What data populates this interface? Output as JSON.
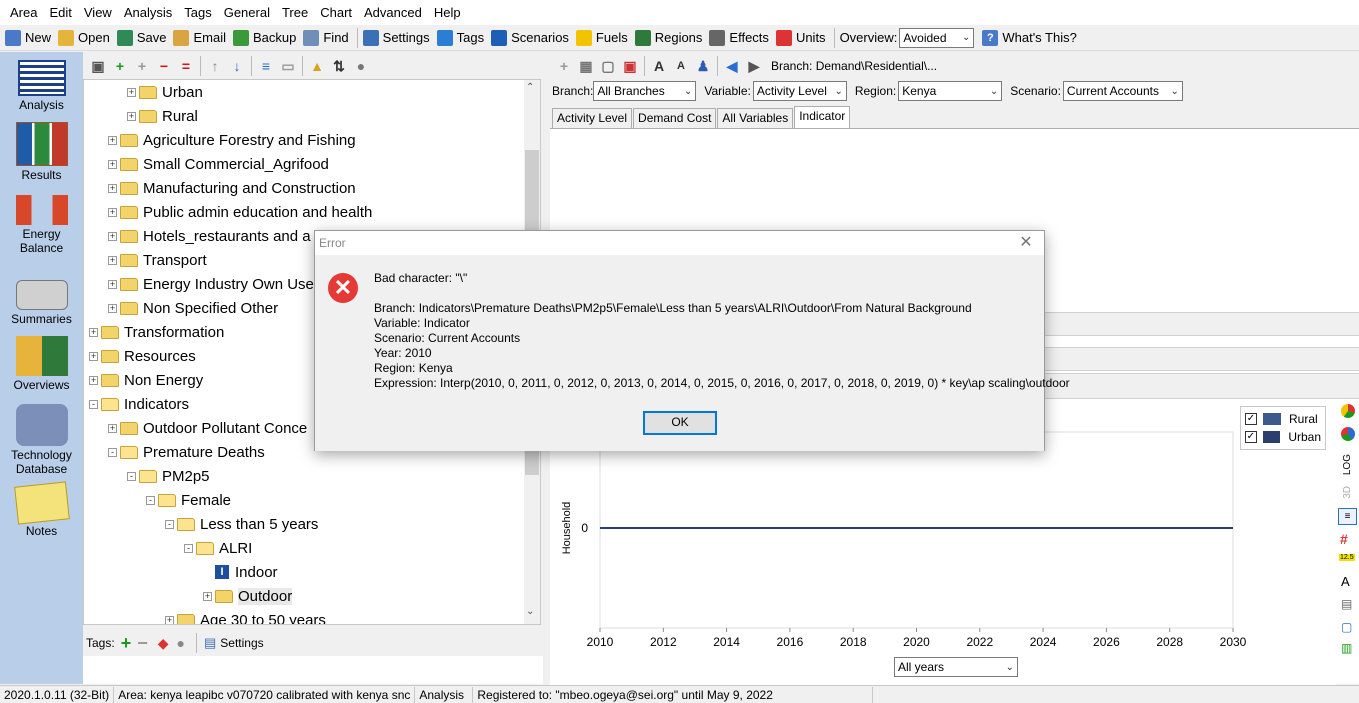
{
  "menu": [
    "Area",
    "Edit",
    "View",
    "Analysis",
    "Tags",
    "General",
    "Tree",
    "Chart",
    "Advanced",
    "Help"
  ],
  "toolbar": {
    "items": [
      {
        "label": "New",
        "icon": "new-file-icon",
        "color": "#4a79c9"
      },
      {
        "label": "Open",
        "icon": "open-folder-icon",
        "color": "#e4b43b"
      },
      {
        "label": "Save",
        "icon": "save-icon",
        "color": "#2e8b57"
      },
      {
        "label": "Email",
        "icon": "email-icon",
        "color": "#d9a441"
      },
      {
        "label": "Backup",
        "icon": "backup-icon",
        "color": "#3a9a3a"
      },
      {
        "label": "Find",
        "icon": "find-icon",
        "color": "#6f8fb8"
      }
    ],
    "items2": [
      {
        "label": "Settings",
        "icon": "settings-icon",
        "color": "#3b6fb6"
      },
      {
        "label": "Tags",
        "icon": "tag-icon",
        "color": "#2a7fd4"
      },
      {
        "label": "Scenarios",
        "icon": "scenarios-icon",
        "color": "#1d5fb5"
      },
      {
        "label": "Fuels",
        "icon": "fuels-icon",
        "color": "#f2c400"
      },
      {
        "label": "Regions",
        "icon": "globe-icon",
        "color": "#2f7a3a"
      },
      {
        "label": "Effects",
        "icon": "effects-cloud-icon",
        "color": "#666"
      },
      {
        "label": "Units",
        "icon": "units-icon",
        "color": "#d33"
      }
    ],
    "overview_label": "Overview:",
    "overview_value": "Avoided",
    "whats_this": "What's This?"
  },
  "sidebar": [
    {
      "label": "Analysis",
      "icon": "analysis-icon"
    },
    {
      "label": "Results",
      "icon": "results-chart-icon"
    },
    {
      "label": "Energy Balance",
      "icon": "energy-balance-icon"
    },
    {
      "label": "Summaries",
      "icon": "summaries-icon"
    },
    {
      "label": "Overviews",
      "icon": "overviews-icon"
    },
    {
      "label": "Technology Database",
      "icon": "technology-database-icon"
    },
    {
      "label": "Notes",
      "icon": "notes-icon"
    }
  ],
  "tree": [
    {
      "label": "Urban",
      "level": 2,
      "exp": "+"
    },
    {
      "label": "Rural",
      "level": 2,
      "exp": "+"
    },
    {
      "label": "Agriculture Forestry and Fishing",
      "level": 1,
      "exp": "+"
    },
    {
      "label": "Small Commercial_Agrifood",
      "level": 1,
      "exp": "+"
    },
    {
      "label": "Manufacturing and Construction",
      "level": 1,
      "exp": "+"
    },
    {
      "label": "Public admin education and health",
      "level": 1,
      "exp": "+"
    },
    {
      "label": "Hotels_restaurants and a",
      "level": 1,
      "exp": "+"
    },
    {
      "label": "Transport",
      "level": 1,
      "exp": "+"
    },
    {
      "label": "Energy Industry Own Use",
      "level": 1,
      "exp": "+"
    },
    {
      "label": "Non Specified Other",
      "level": 1,
      "exp": "+"
    },
    {
      "label": "Transformation",
      "level": 0,
      "exp": "+"
    },
    {
      "label": "Resources",
      "level": 0,
      "exp": "+"
    },
    {
      "label": "Non Energy",
      "level": 0,
      "exp": "+"
    },
    {
      "label": "Indicators",
      "level": 0,
      "exp": "-"
    },
    {
      "label": "Outdoor Pollutant Conce",
      "level": 1,
      "exp": "+"
    },
    {
      "label": "Premature Deaths",
      "level": 1,
      "exp": "-"
    },
    {
      "label": "PM2p5",
      "level": 2,
      "exp": "-"
    },
    {
      "label": "Female",
      "level": 3,
      "exp": "-"
    },
    {
      "label": "Less than 5 years",
      "level": 4,
      "exp": "-"
    },
    {
      "label": "ALRI",
      "level": 5,
      "exp": "-"
    },
    {
      "label": "Indoor",
      "level": 6,
      "exp": "",
      "type": "indicator"
    },
    {
      "label": "Outdoor",
      "level": 6,
      "exp": "+",
      "selected": true
    },
    {
      "label": "Age 30 to 50 years",
      "level": 4,
      "exp": "+"
    }
  ],
  "tags_bar": {
    "label": "Tags:",
    "settings": "Settings"
  },
  "branch_path": "Branch: Demand\\Residential\\...",
  "selectors": {
    "branch_label": "Branch:",
    "branch_value": "All Branches",
    "variable_label": "Variable:",
    "variable_value": "Activity Level",
    "region_label": "Region:",
    "region_value": "Kenya",
    "scenario_label": "Scenario:",
    "scenario_value": "Current Accounts"
  },
  "tabs": [
    "Activity Level",
    "Demand Cost",
    "All Variables",
    "Indicator"
  ],
  "chart_data": {
    "type": "line",
    "x": [
      2010,
      2012,
      2014,
      2016,
      2018,
      2020,
      2022,
      2024,
      2026,
      2028,
      2030
    ],
    "ylabel": "Household",
    "yticks": [
      0
    ],
    "series": [
      {
        "name": "Rural",
        "color": "#3c5a8c",
        "values": [
          0,
          0,
          0,
          0,
          0,
          0,
          0,
          0,
          0,
          0,
          0
        ]
      },
      {
        "name": "Urban",
        "color": "#2b3f6e",
        "values": [
          0,
          0,
          0,
          0,
          0,
          0,
          0,
          0,
          0,
          0,
          0
        ]
      }
    ]
  },
  "chart_side": {
    "log": "LOG",
    "three_d": "3D",
    "badge": "12.5"
  },
  "years_combo": "All years",
  "statusbar": [
    "2020.1.0.11 (32-Bit)",
    "Area: kenya leapibc v070720 calibrated with kenya snc",
    "Analysis",
    "Registered to: \"mbeo.ogeya@sei.org\" until May 9, 2022"
  ],
  "dialog": {
    "title": "Error",
    "lines": [
      "Bad character: \"\\\"",
      "",
      "Branch: Indicators\\Premature Deaths\\PM2p5\\Female\\Less than 5 years\\ALRI\\Outdoor\\From Natural Background",
      "Variable: Indicator",
      "Scenario: Current Accounts",
      "Year: 2010",
      "Region: Kenya",
      "Expression: Interp(2010, 0, 2011, 0, 2012, 0, 2013, 0, 2014, 0, 2015, 0, 2016, 0, 2017, 0, 2018, 0, 2019, 0) * key\\ap scaling\\outdoor"
    ],
    "ok": "OK"
  }
}
